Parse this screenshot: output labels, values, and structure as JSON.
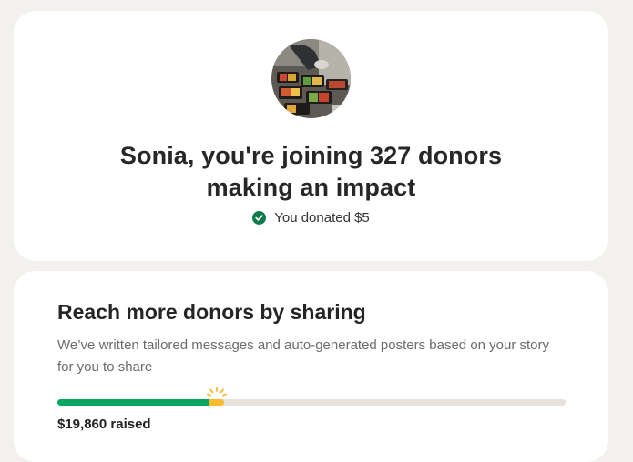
{
  "donation_card": {
    "headline_line1": "Sonia, you're joining 327 donors",
    "headline_line2": "making an impact",
    "donated_text": "You donated $5",
    "check_icon": "check-circle-icon",
    "accent_color": "#0f7b4b"
  },
  "share_card": {
    "title": "Reach more donors by sharing",
    "description": "We’ve written tailored messages and auto-generated posters based on your story for you to share",
    "raised_text": "$19,860 raised",
    "progress": {
      "previous_fraction": 0.298,
      "donation_fraction": 0.03,
      "fill_color": "#05a660",
      "new_donation_color": "#f9bb2d",
      "track_color": "#e6e2d9"
    }
  }
}
